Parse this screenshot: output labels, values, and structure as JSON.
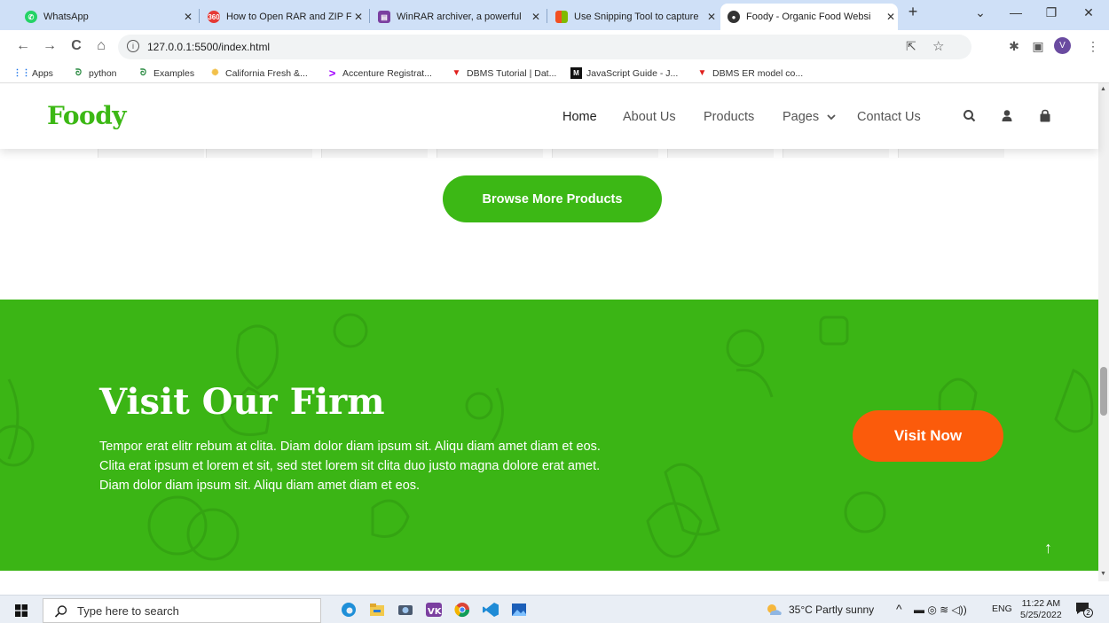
{
  "browser": {
    "tabs": [
      {
        "title": "WhatsApp",
        "icon": "whatsapp-icon",
        "color": "#25d366"
      },
      {
        "title": "How to Open RAR and ZIP Fi",
        "icon": "360-icon",
        "color": "#e53935"
      },
      {
        "title": "WinRAR archiver, a powerful",
        "icon": "winrar-icon",
        "color": "#7b3fa0"
      },
      {
        "title": "Use Snipping Tool to capture",
        "icon": "microsoft-icon",
        "color": "#f25022"
      },
      {
        "title": "Foody - Organic Food Websi",
        "icon": "globe-icon",
        "color": "#333333"
      }
    ],
    "url": "127.0.0.1:5500/index.html",
    "profile_initial": "V",
    "bookmarks": [
      {
        "label": "Apps",
        "icon": "apps-grid-icon"
      },
      {
        "label": "python",
        "icon": "gfg-icon"
      },
      {
        "label": "Examples",
        "icon": "gfg-icon"
      },
      {
        "label": "California Fresh &...",
        "icon": "sun-icon"
      },
      {
        "label": "Accenture Registrat...",
        "icon": "accenture-icon"
      },
      {
        "label": "DBMS Tutorial | Dat...",
        "icon": "tutorialspoint-icon"
      },
      {
        "label": "JavaScript Guide - J...",
        "icon": "mdn-icon"
      },
      {
        "label": "DBMS ER model co...",
        "icon": "tutorialspoint-icon"
      }
    ]
  },
  "site": {
    "logo": "Foody",
    "nav": {
      "home": "Home",
      "about": "About Us",
      "products": "Products",
      "pages": "Pages",
      "contact": "Contact Us"
    },
    "browse_label": "Browse More Products",
    "firm": {
      "title": "Visit Our Firm",
      "text": "Tempor erat elitr rebum at clita. Diam dolor diam ipsum sit. Aliqu diam amet diam et eos. Clita erat ipsum et lorem et sit, sed stet lorem sit clita duo justo magna dolore erat amet. Diam dolor diam ipsum sit. Aliqu diam amet diam et eos.",
      "button": "Visit Now"
    },
    "colors": {
      "primary": "#3cb815",
      "accent": "#fb5b0b"
    }
  },
  "taskbar": {
    "search_placeholder": "Type here to search",
    "weather": "35°C  Partly sunny",
    "lang": "ENG",
    "time": "11:22 AM",
    "date": "5/25/2022",
    "notification_count": "2"
  }
}
